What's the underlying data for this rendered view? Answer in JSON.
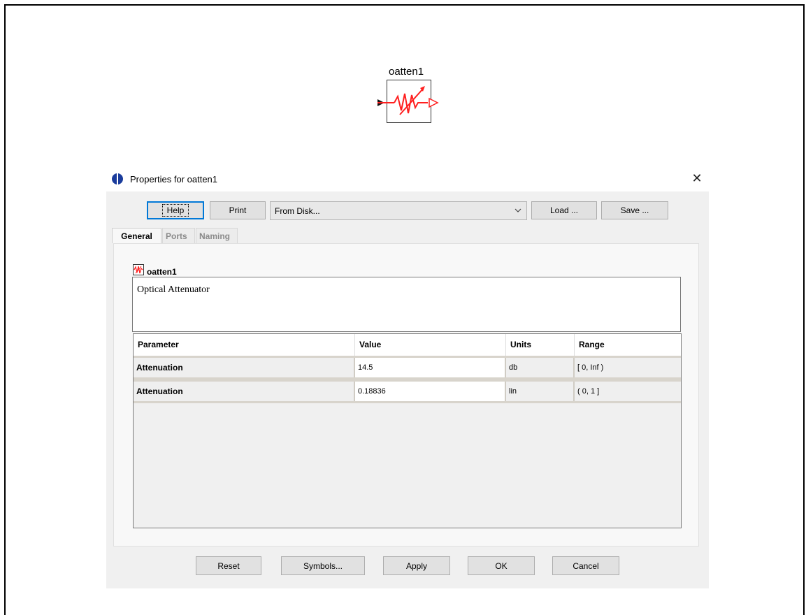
{
  "canvas": {
    "component_label": "oatten1"
  },
  "dialog": {
    "title": "Properties for oatten1",
    "toolbar": {
      "help": "Help",
      "print": "Print",
      "source_select": "From Disk...",
      "load": "Load ...",
      "save": "Save ..."
    },
    "tabs": [
      {
        "label": "General"
      },
      {
        "label": "Ports"
      },
      {
        "label": "Naming"
      }
    ],
    "component": {
      "name": "oatten1",
      "description": "Optical Attenuator"
    },
    "table": {
      "headers": [
        "Parameter",
        "Value",
        "Units",
        "Range"
      ],
      "rows": [
        {
          "parameter": "Attenuation",
          "value": "14.5",
          "units": "db",
          "range": "[ 0, Inf )"
        },
        {
          "parameter": "Attenuation",
          "value": "0.18836",
          "units": "lin",
          "range": "( 0, 1 ]"
        }
      ]
    },
    "footer": {
      "reset": "Reset",
      "symbols": "Symbols...",
      "apply": "Apply",
      "ok": "OK",
      "cancel": "Cancel"
    }
  },
  "colors": {
    "symbol_red": "#ff1f1f",
    "title_icon_blue": "#1a3c9c"
  }
}
